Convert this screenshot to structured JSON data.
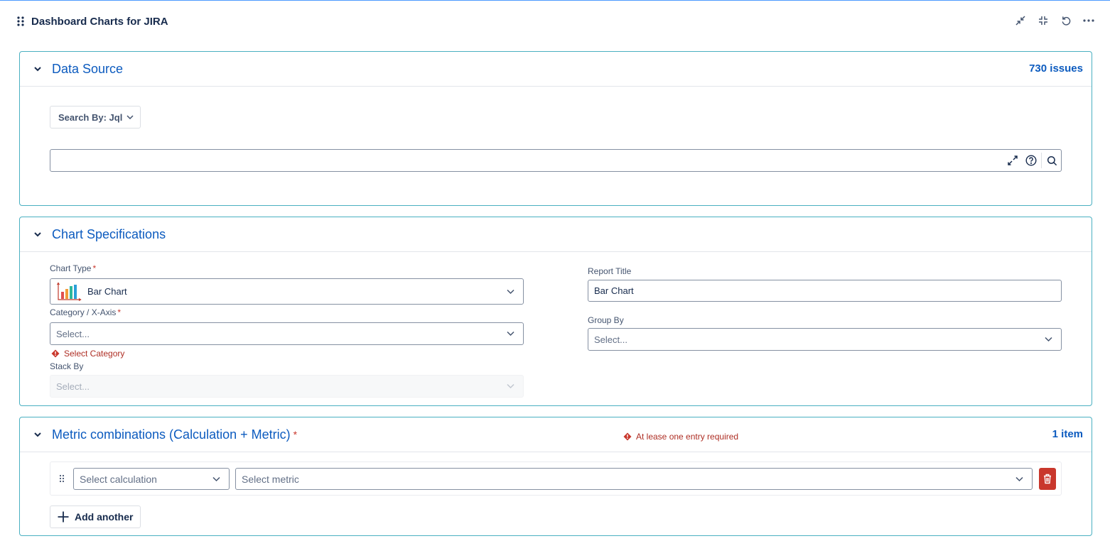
{
  "gadget": {
    "title": "Dashboard Charts for JIRA",
    "actions": [
      "minimize-icon",
      "collapse-icon",
      "refresh-icon",
      "more-icon"
    ]
  },
  "data_source": {
    "title": "Data Source",
    "count": "730 issues",
    "search_by_label": "Search By: Jql",
    "jql_value": "",
    "icons": [
      "expand-icon",
      "help-icon",
      "search-icon"
    ]
  },
  "chart_spec": {
    "title": "Chart Specifications",
    "chart_type_label": "Chart Type",
    "chart_type_value": "Bar Chart",
    "category_label": "Category / X-Axis",
    "category_placeholder": "Select...",
    "category_error": "Select Category",
    "stack_by_label": "Stack By",
    "stack_by_placeholder": "Select...",
    "report_title_label": "Report Title",
    "report_title_value": "Bar Chart",
    "group_by_label": "Group By",
    "group_by_placeholder": "Select...",
    "required_mark": "*"
  },
  "metrics": {
    "title": "Metric combinations (Calculation + Metric)",
    "required_mark": "*",
    "error": "At lease one entry required",
    "count": "1 item",
    "calc_placeholder": "Select calculation",
    "metric_placeholder": "Select metric",
    "add_label": "Add another"
  },
  "colors": {
    "accent": "#0c5bbf",
    "panel_border": "#4ab0c1",
    "error": "#ae2e24",
    "danger_button": "#c9372c"
  }
}
